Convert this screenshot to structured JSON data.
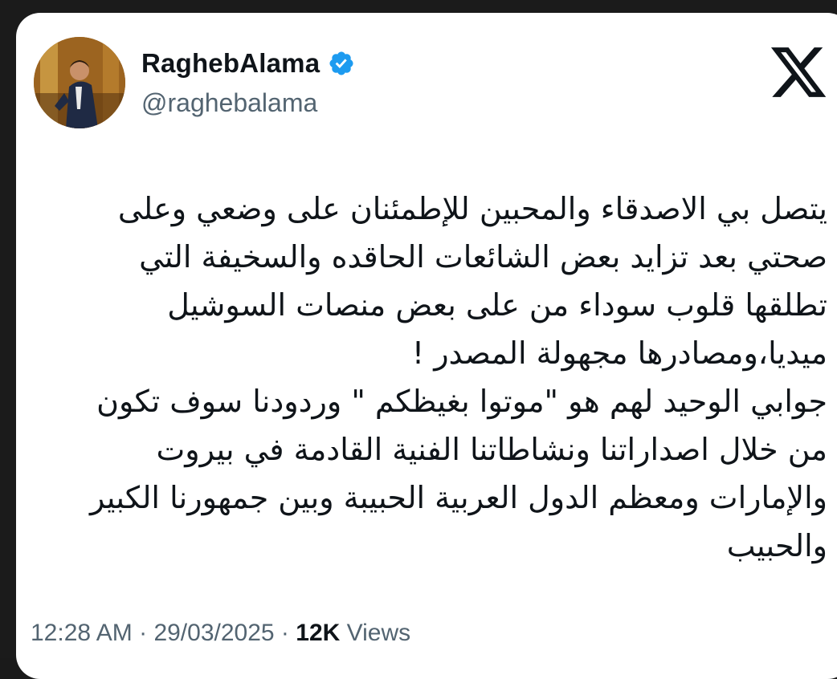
{
  "author": {
    "display_name": "RaghebAlama",
    "handle": "@raghebalama",
    "verified": true
  },
  "icons": {
    "verified": "verified-badge-icon",
    "brand": "x-logo-icon",
    "accent_color": "#1d9bf0"
  },
  "tweet": {
    "lines": [
      "يتصل بي الاصدقاء والمحبين للإطمئنان على وضعي وعلى",
      "صحتي بعد تزايد بعض الشائعات الحاقده والسخيفة  التي",
      "تطلقها قلوب سوداء من على بعض منصات السوشيل",
      "ميديا،ومصادرها مجهولة المصدر !",
      "جوابي الوحيد لهم هو \"موتوا بغيظكم \" وردودنا سوف تكون",
      "من خلال اصداراتنا ونشاطاتنا الفنية القادمة في بيروت",
      "والإمارات ومعظم الدول العربية الحبيبة وبين جمهورنا الكبير",
      "والحبيب"
    ]
  },
  "meta": {
    "time": "12:28 AM",
    "separator": " · ",
    "date": "29/03/2025",
    "views_count": "12K",
    "views_label": "Views"
  }
}
